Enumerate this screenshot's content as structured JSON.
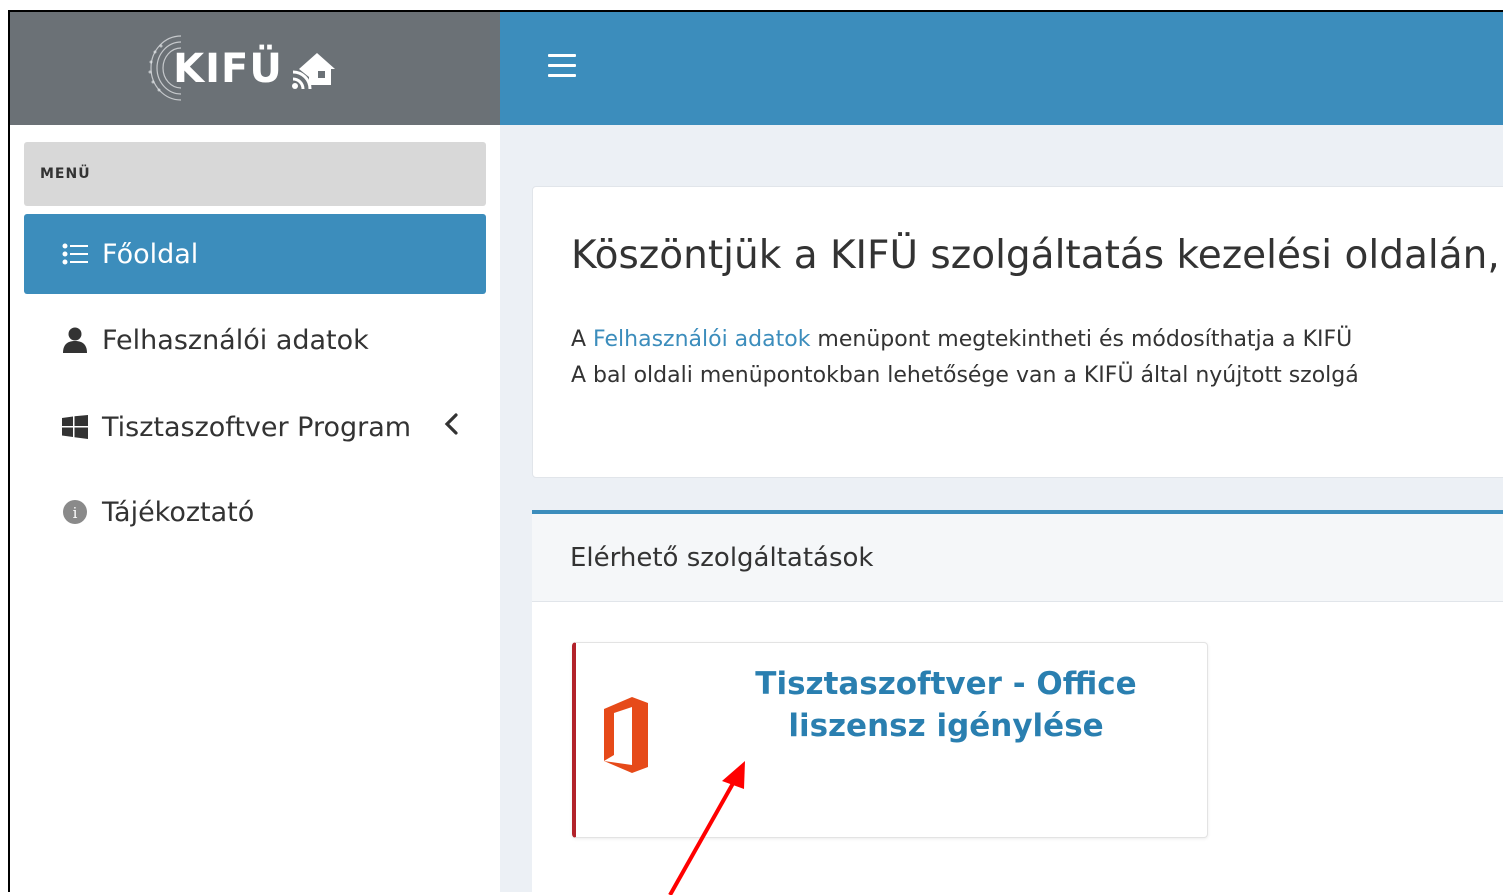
{
  "logo": {
    "text": "KIFÜ"
  },
  "sidebar": {
    "menu_header": "MENÜ",
    "items": [
      {
        "label": "Főoldal",
        "icon": "list-icon",
        "active": true
      },
      {
        "label": "Felhasználói adatok",
        "icon": "user-icon"
      },
      {
        "label": "Tisztaszoftver Program",
        "icon": "windows-icon",
        "has_submenu": true
      },
      {
        "label": "Tájékoztató",
        "icon": "info-icon"
      }
    ]
  },
  "topbar": {
    "menu_icon": "hamburger-icon"
  },
  "welcome": {
    "title": "Köszöntjük a KIFÜ szolgáltatás kezelési oldalán,",
    "line1_prefix": "A ",
    "line1_link": "Felhasználói adatok",
    "line1_suffix": " menüpont megtekintheti és módosíthatja a KIFÜ",
    "line2": "A bal oldali menüpontokban lehetősége van a KIFÜ által nyújtott szolgá"
  },
  "services": {
    "header": "Elérhető szolgáltatások",
    "items": [
      {
        "title": "Tisztaszoftver - Office\nliszensz igénylése",
        "icon": "office-icon"
      }
    ]
  },
  "colors": {
    "primary": "#3c8dbc",
    "logo_bar": "#6b7176",
    "accent_border": "#b2222a",
    "office": "#e64a19",
    "annotation_arrow": "#ff0000"
  }
}
